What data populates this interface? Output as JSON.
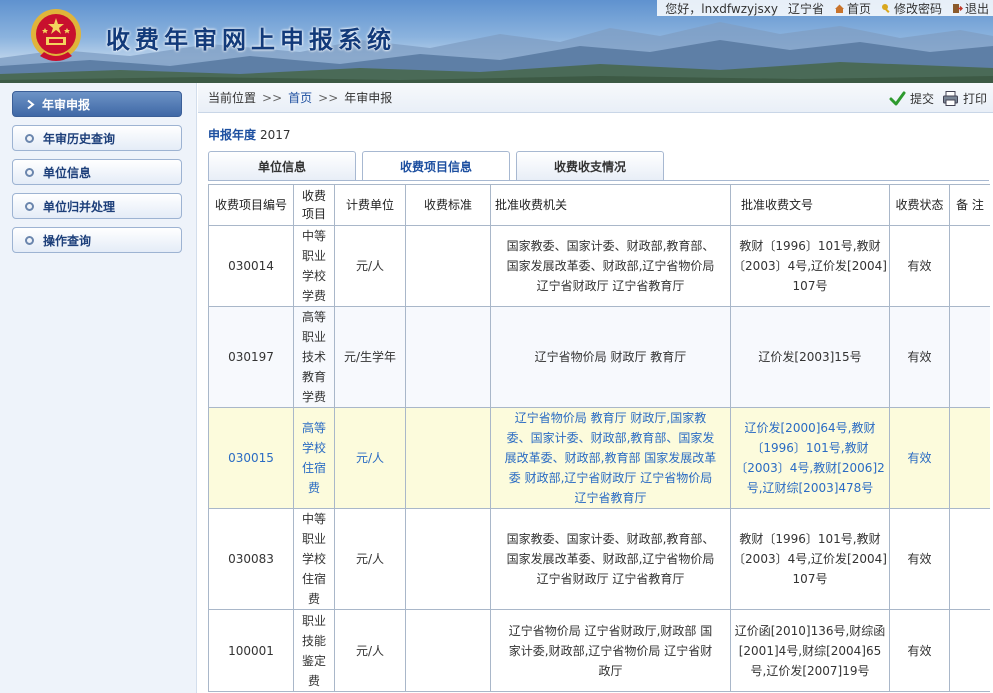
{
  "header": {
    "site_title": "收费年审网上申报系统",
    "greeting": "您好，lnxdfwzyjsxy",
    "region": "辽宁省",
    "links": [
      {
        "label": "首页",
        "icon": "home-icon"
      },
      {
        "label": "修改密码",
        "icon": "key-icon"
      },
      {
        "label": "退出",
        "icon": "exit-icon"
      }
    ]
  },
  "sidebar": {
    "items": [
      {
        "label": "年审申报",
        "active": true
      },
      {
        "label": "年审历史查询",
        "active": false
      },
      {
        "label": "单位信息",
        "active": false
      },
      {
        "label": "单位归并处理",
        "active": false
      },
      {
        "label": "操作查询",
        "active": false
      }
    ]
  },
  "breadcrumb": {
    "prefix": "当前位置",
    "sep1": ">>",
    "home": "首页",
    "sep2": ">>",
    "current": "年审申报"
  },
  "actions": {
    "submit": "提交",
    "print": "打印"
  },
  "report_year": {
    "label": "申报年度",
    "value": "2017"
  },
  "tabs": [
    {
      "label": "单位信息",
      "active": false
    },
    {
      "label": "收费项目信息",
      "active": true
    },
    {
      "label": "收费收支情况",
      "active": false
    }
  ],
  "table": {
    "headers": [
      "收费项目编号",
      "收费项目",
      "计费单位",
      "收费标准",
      "批准收费机关",
      "批准收费文号",
      "收费状态",
      "备 注"
    ],
    "rows": [
      {
        "code": "030014",
        "name": [
          "中等",
          "职业",
          "学校",
          "学费"
        ],
        "unit": "元/人",
        "standard": "",
        "authority": [
          "国家教委、国家计委、财政部,教育部、",
          "国家发展改革委、财政部,辽宁省物价局",
          "辽宁省财政厅 辽宁省教育厅"
        ],
        "docno": [
          "教财〔1996〕101号,教财",
          "〔2003〕4号,辽价发[2004]",
          "107号"
        ],
        "status": "有效",
        "remark": ""
      },
      {
        "code": "030197",
        "name": [
          "高等",
          "职业",
          "技术",
          "教育",
          "学费"
        ],
        "unit": "元/生学年",
        "standard": "",
        "authority": [
          "辽宁省物价局 财政厅 教育厅"
        ],
        "docno": [
          "辽价发[2003]15号"
        ],
        "status": "有效",
        "remark": ""
      },
      {
        "code": "030015",
        "name": [
          "高等",
          "学校",
          "住宿",
          "费"
        ],
        "unit": "元/人",
        "standard": "",
        "authority": [
          "辽宁省物价局 教育厅 财政厅,国家教",
          "委、国家计委、财政部,教育部、国家发",
          "展改革委、财政部,教育部 国家发展改革",
          "委 财政部,辽宁省财政厅 辽宁省物价局",
          "辽宁省教育厅"
        ],
        "docno": [
          "辽价发[2000]64号,教财",
          "〔1996〕101号,教财",
          "〔2003〕4号,教财[2006]2",
          "号,辽财综[2003]478号"
        ],
        "status": "有效",
        "remark": "",
        "highlighted": true
      },
      {
        "code": "030083",
        "name": [
          "中等",
          "职业",
          "学校",
          "住宿",
          "费"
        ],
        "unit": "元/人",
        "standard": "",
        "authority": [
          "国家教委、国家计委、财政部,教育部、",
          "国家发展改革委、财政部,辽宁省物价局",
          "辽宁省财政厅 辽宁省教育厅"
        ],
        "docno": [
          "教财〔1996〕101号,教财",
          "〔2003〕4号,辽价发[2004]",
          "107号"
        ],
        "status": "有效",
        "remark": ""
      },
      {
        "code": "100001",
        "name": [
          "职业",
          "技能",
          "鉴定",
          "费"
        ],
        "unit": "元/人",
        "standard": "",
        "authority": [
          "辽宁省物价局 辽宁省财政厅,财政部 国",
          "家计委,财政部,辽宁省物价局 辽宁省财",
          "政厅"
        ],
        "docno": [
          "辽价函[2010]136号,财综函",
          "[2001]4号,财综[2004]65",
          "号,辽价发[2007]19号"
        ],
        "status": "有效",
        "remark": ""
      }
    ]
  },
  "colors": {
    "accent": "#1d4fa0",
    "highlight_row": "#fcfbdc",
    "highlight_text": "#2a6bc3",
    "sidebar_active": "#3f68a6"
  }
}
